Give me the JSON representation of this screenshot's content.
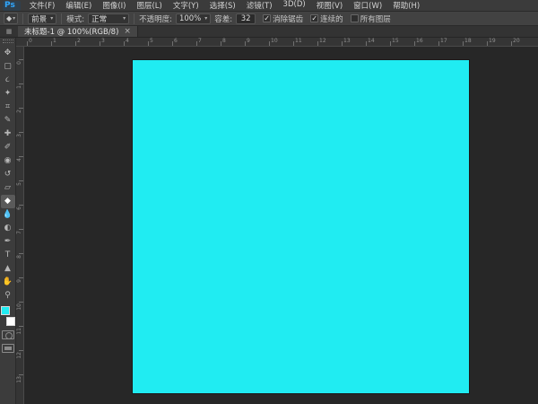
{
  "window": {
    "logo": "Ps"
  },
  "menu_bar": {
    "items": [
      "文件(F)",
      "编辑(E)",
      "图像(I)",
      "图层(L)",
      "文字(Y)",
      "选择(S)",
      "滤镜(T)",
      "3D(D)",
      "视图(V)",
      "窗口(W)",
      "帮助(H)"
    ]
  },
  "options_bar": {
    "tool_icon": "paint-bucket",
    "tool_glyph": "◆",
    "source_dropdown": "前景",
    "mode_label": "模式:",
    "mode_value": "正常",
    "opacity_label": "不透明度:",
    "opacity_value": "100%",
    "tolerance_label": "容差:",
    "tolerance_value": "32",
    "checkboxes": [
      {
        "label": "消除锯齿",
        "checked": true
      },
      {
        "label": "连续的",
        "checked": true
      },
      {
        "label": "所有图层",
        "checked": false
      }
    ]
  },
  "tab_bar": {
    "doc_title": "未标题-1 @ 100%(RGB/8)",
    "close_glyph": "×"
  },
  "toolbar": {
    "tools": [
      {
        "name": "move-tool",
        "glyph": "✥",
        "selected": false
      },
      {
        "name": "rectangular-marquee-tool",
        "glyph": "▢",
        "selected": false
      },
      {
        "name": "lasso-tool",
        "glyph": "૮",
        "selected": false
      },
      {
        "name": "quick-selection-tool",
        "glyph": "✦",
        "selected": false
      },
      {
        "name": "crop-tool",
        "glyph": "⌗",
        "selected": false
      },
      {
        "name": "eyedropper-tool",
        "glyph": "✎",
        "selected": false
      },
      {
        "name": "healing-brush-tool",
        "glyph": "✚",
        "selected": false
      },
      {
        "name": "brush-tool",
        "glyph": "✐",
        "selected": false
      },
      {
        "name": "clone-stamp-tool",
        "glyph": "◉",
        "selected": false
      },
      {
        "name": "history-brush-tool",
        "glyph": "↺",
        "selected": false
      },
      {
        "name": "eraser-tool",
        "glyph": "▱",
        "selected": false
      },
      {
        "name": "paint-bucket-tool",
        "glyph": "◆",
        "selected": true
      },
      {
        "name": "blur-tool",
        "glyph": "💧",
        "selected": false
      },
      {
        "name": "dodge-tool",
        "glyph": "◐",
        "selected": false
      },
      {
        "name": "pen-tool",
        "glyph": "✒",
        "selected": false
      },
      {
        "name": "type-tool",
        "glyph": "T",
        "selected": false
      },
      {
        "name": "path-selection-tool",
        "glyph": "▲",
        "selected": false
      },
      {
        "name": "hand-tool",
        "glyph": "✋",
        "selected": false
      },
      {
        "name": "zoom-tool",
        "glyph": "⚲",
        "selected": false
      }
    ]
  },
  "rulers": {
    "horizontal_labels": [
      "0",
      "1",
      "2",
      "3",
      "4",
      "5",
      "6",
      "7",
      "8",
      "9",
      "10",
      "11",
      "12",
      "13",
      "14",
      "15",
      "16",
      "17",
      "18",
      "19",
      "20"
    ],
    "vertical_labels": [
      "0",
      "1",
      "2",
      "3",
      "4",
      "5",
      "6",
      "7",
      "8",
      "9",
      "10",
      "11",
      "12",
      "13"
    ]
  },
  "colors": {
    "canvas_fill": "#20ECF2",
    "foreground_swatch": "#20ECF2",
    "background_swatch": "#FFFFFF"
  }
}
